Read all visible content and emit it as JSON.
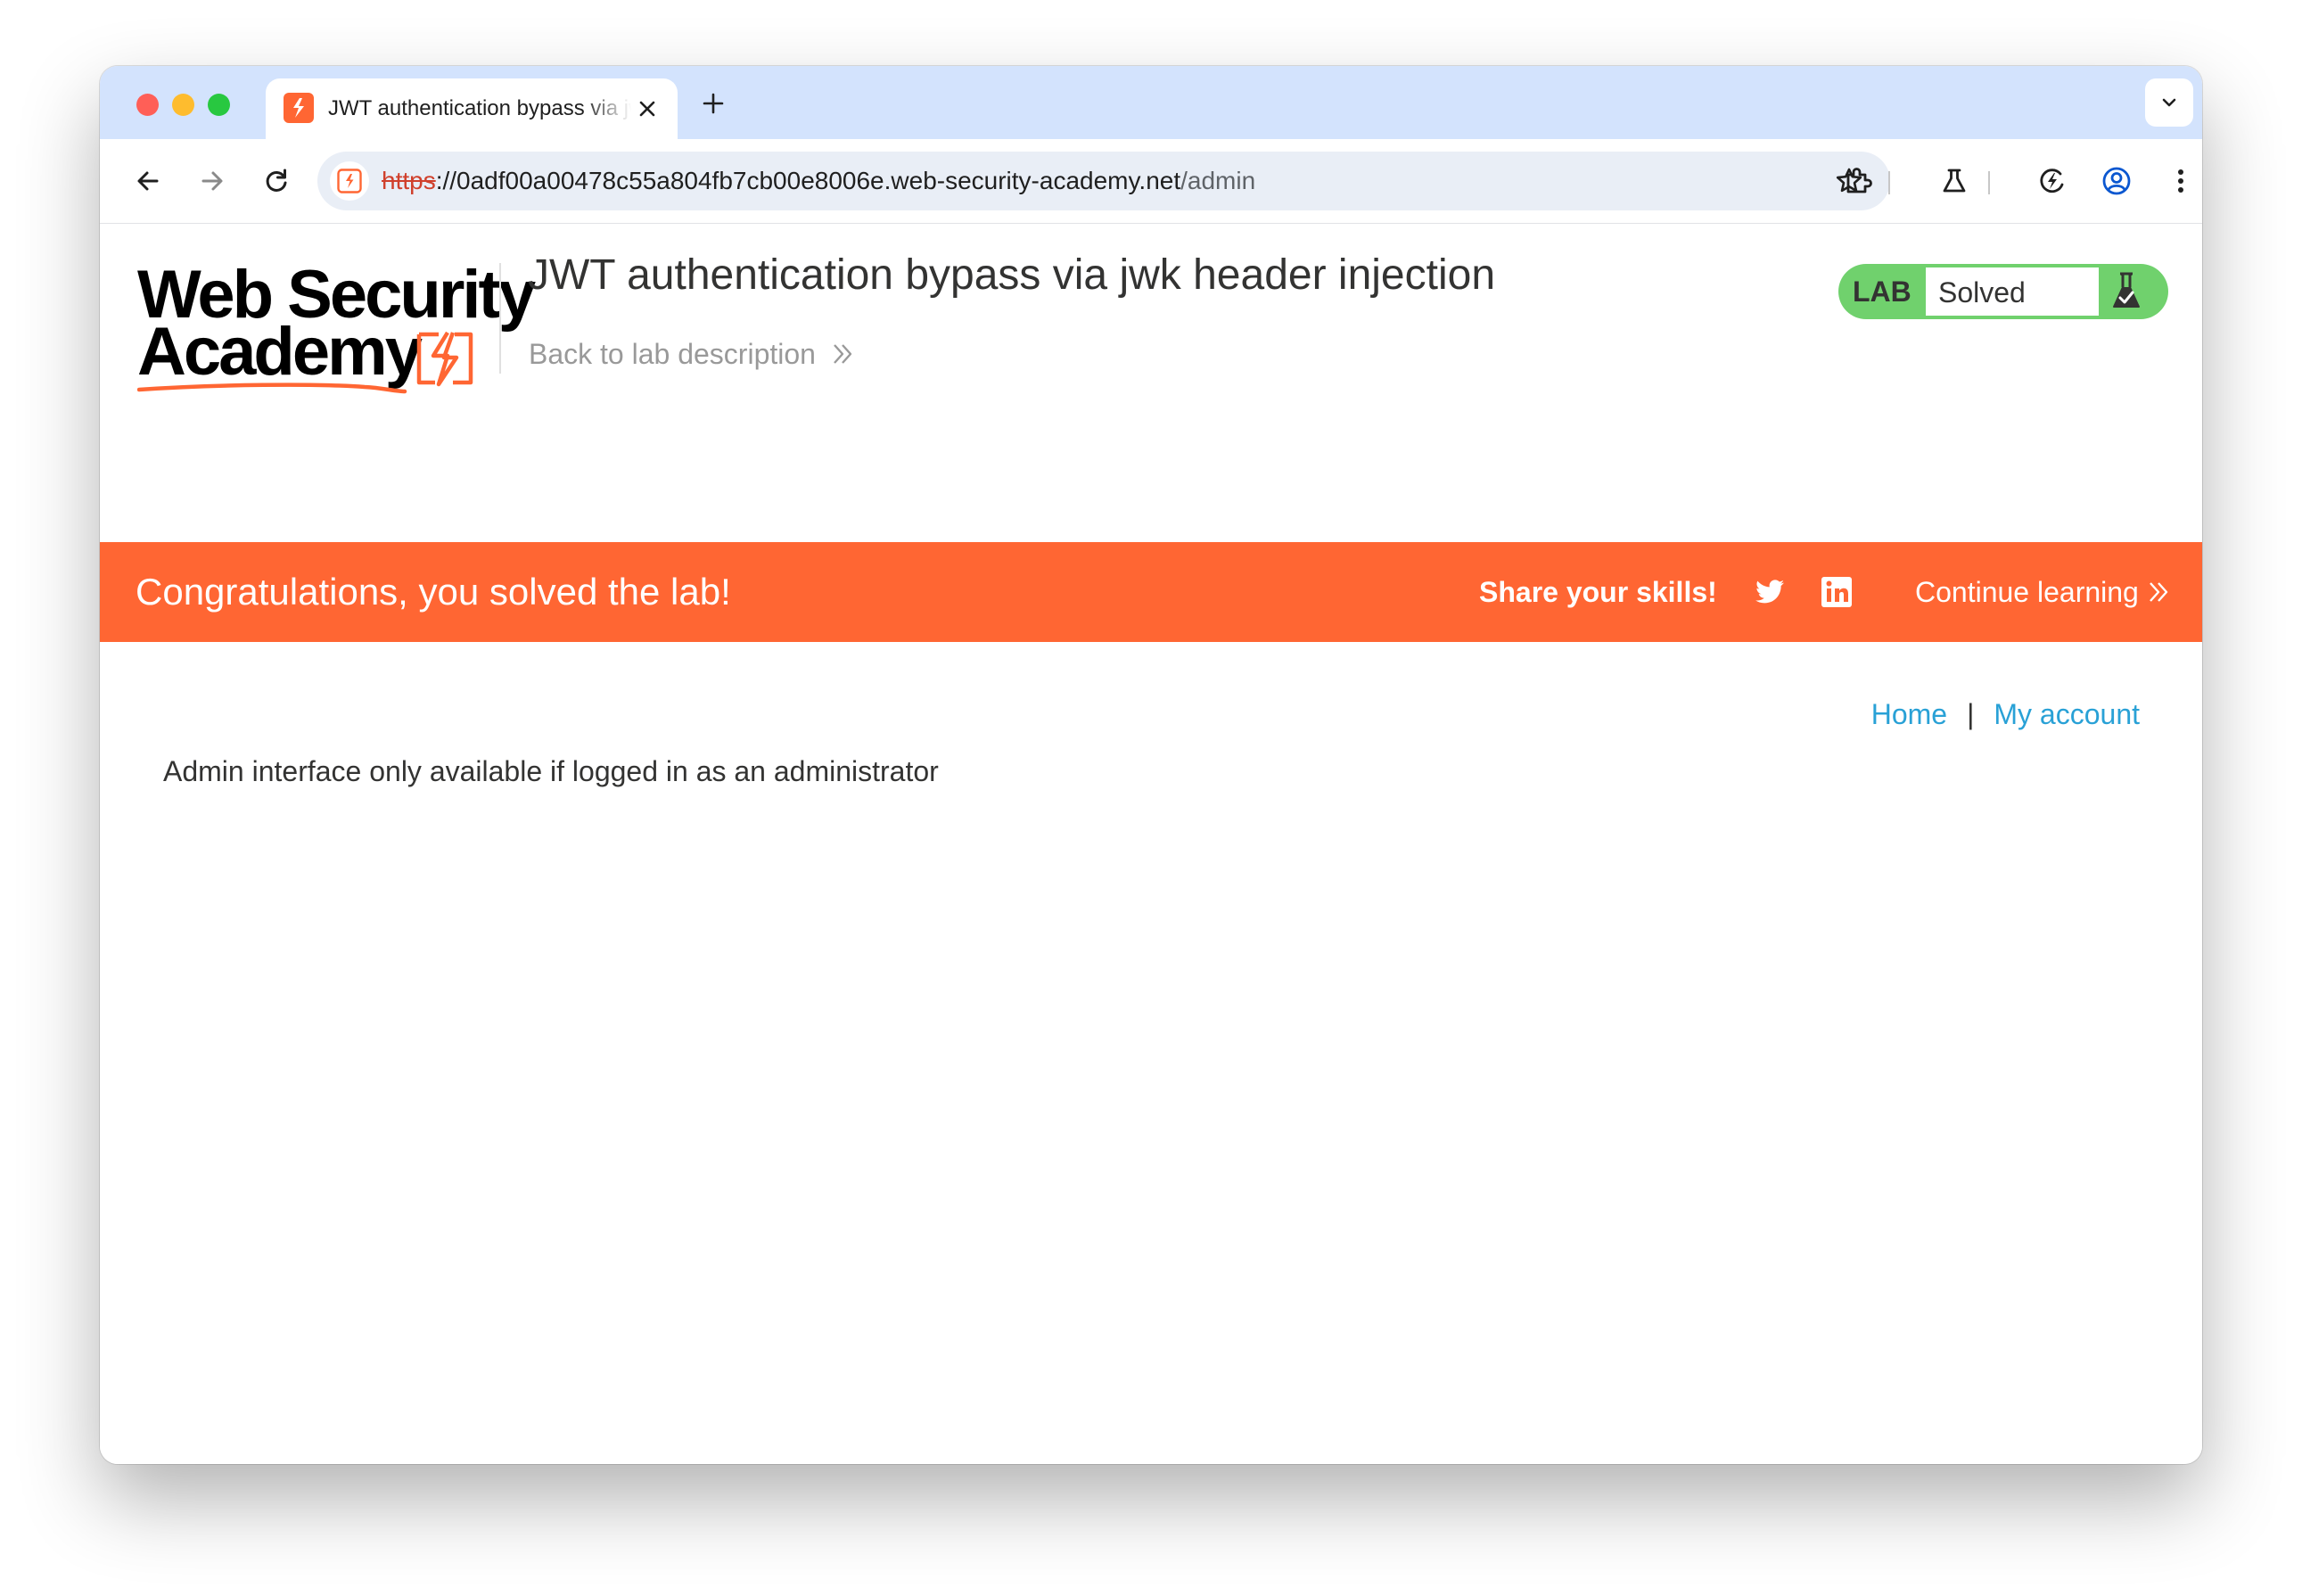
{
  "browser": {
    "tab_title": "JWT authentication bypass via jwk header injection",
    "url_scheme": "https",
    "url_host": "://0adf00a00478c55a804fb7cb00e8006e.web-security-academy.net",
    "url_path": "/admin"
  },
  "header": {
    "logo_line1": "Web Security",
    "logo_line2": "Academy",
    "lab_title": "JWT authentication bypass via jwk header injection",
    "back_link": "Back to lab description",
    "lab_badge": "LAB",
    "lab_status": "Solved"
  },
  "banner": {
    "message": "Congratulations, you solved the lab!",
    "share_label": "Share your skills!",
    "continue_label": "Continue learning"
  },
  "nav": {
    "home": "Home",
    "separator": "|",
    "account": "My account"
  },
  "content": {
    "admin_message": "Admin interface only available if logged in as an administrator"
  },
  "colors": {
    "brand_orange": "#ff6633",
    "lab_green": "#70d16d",
    "link_blue": "#29a1d6",
    "tabstrip": "#d3e3fd"
  },
  "icons": [
    "back-icon",
    "forward-icon",
    "reload-icon",
    "site-info-icon",
    "bookmark-star-icon",
    "extensions-icon",
    "labs-flask-icon",
    "performance-icon",
    "profile-icon",
    "menu-icon",
    "twitter-icon",
    "linkedin-icon",
    "flask-icon"
  ]
}
